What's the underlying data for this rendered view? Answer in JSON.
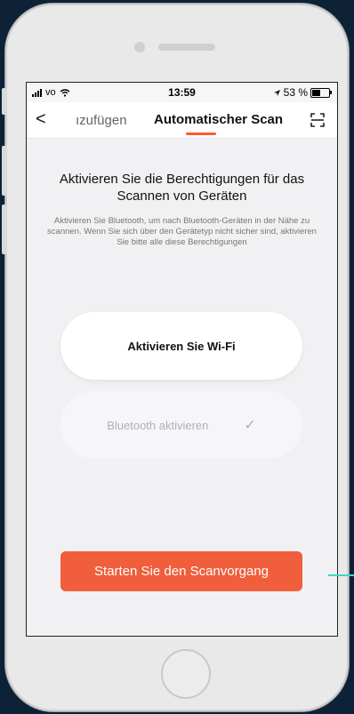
{
  "status_bar": {
    "carrier": "vo",
    "time": "13:59",
    "battery": "53 %"
  },
  "nav": {
    "back_glyph": "<",
    "tab_prev": "ızufügen",
    "tab_active": "Automatischer Scan"
  },
  "main": {
    "title": "Aktivieren Sie die Berechtigungen für das Scannen von Geräten",
    "description": "Aktivieren Sie Bluetooth, um nach Bluetooth-Geräten in der Nähe zu scannen. Wenn Sie sich über den Gerätetyp nicht sicher sind, aktivieren Sie bitte alle diese Berechtigungen",
    "wifi_label": "Aktivieren Sie Wi-Fi",
    "bluetooth_label": "Bluetooth aktivieren",
    "start_label": "Starten Sie den Scanvorgang"
  },
  "colors": {
    "accent": "#f05e3c",
    "background": "#0d2236",
    "connector": "#3fd6c4"
  }
}
